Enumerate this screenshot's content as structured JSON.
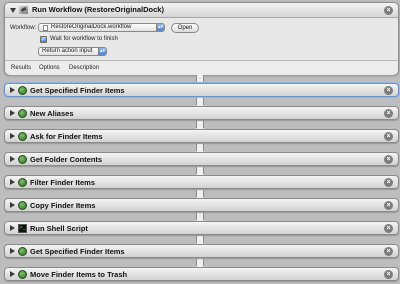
{
  "run_workflow": {
    "title": "Run Workflow (RestoreOriginalDock)",
    "workflow_label": "Workflow:",
    "workflow_value": "RestoreOriginalDock.workflow",
    "open_label": "Open",
    "wait_label": "Wait for workflow to finish",
    "wait_checked": true,
    "output_value": "Return action input",
    "tabs": [
      "Results",
      "Options",
      "Description"
    ]
  },
  "actions": [
    {
      "title": "Get Specified Finder Items",
      "icon": "finder-icon",
      "selected": true
    },
    {
      "title": "New Aliases",
      "icon": "finder-icon",
      "selected": false
    },
    {
      "title": "Ask for Finder Items",
      "icon": "finder-icon",
      "selected": false
    },
    {
      "title": "Get Folder Contents",
      "icon": "finder-icon",
      "selected": false
    },
    {
      "title": "Filter Finder Items",
      "icon": "finder-icon",
      "selected": false
    },
    {
      "title": "Copy Finder Items",
      "icon": "finder-icon",
      "selected": false
    },
    {
      "title": "Run Shell Script",
      "icon": "terminal-icon",
      "selected": false
    },
    {
      "title": "Get Specified Finder Items",
      "icon": "finder-icon",
      "selected": false
    },
    {
      "title": "Move Finder Items to Trash",
      "icon": "finder-icon",
      "selected": false
    }
  ],
  "close_glyph": "×",
  "check_glyph": "✓",
  "popup_arrows": "▴▾",
  "shell_glyph": ">_"
}
